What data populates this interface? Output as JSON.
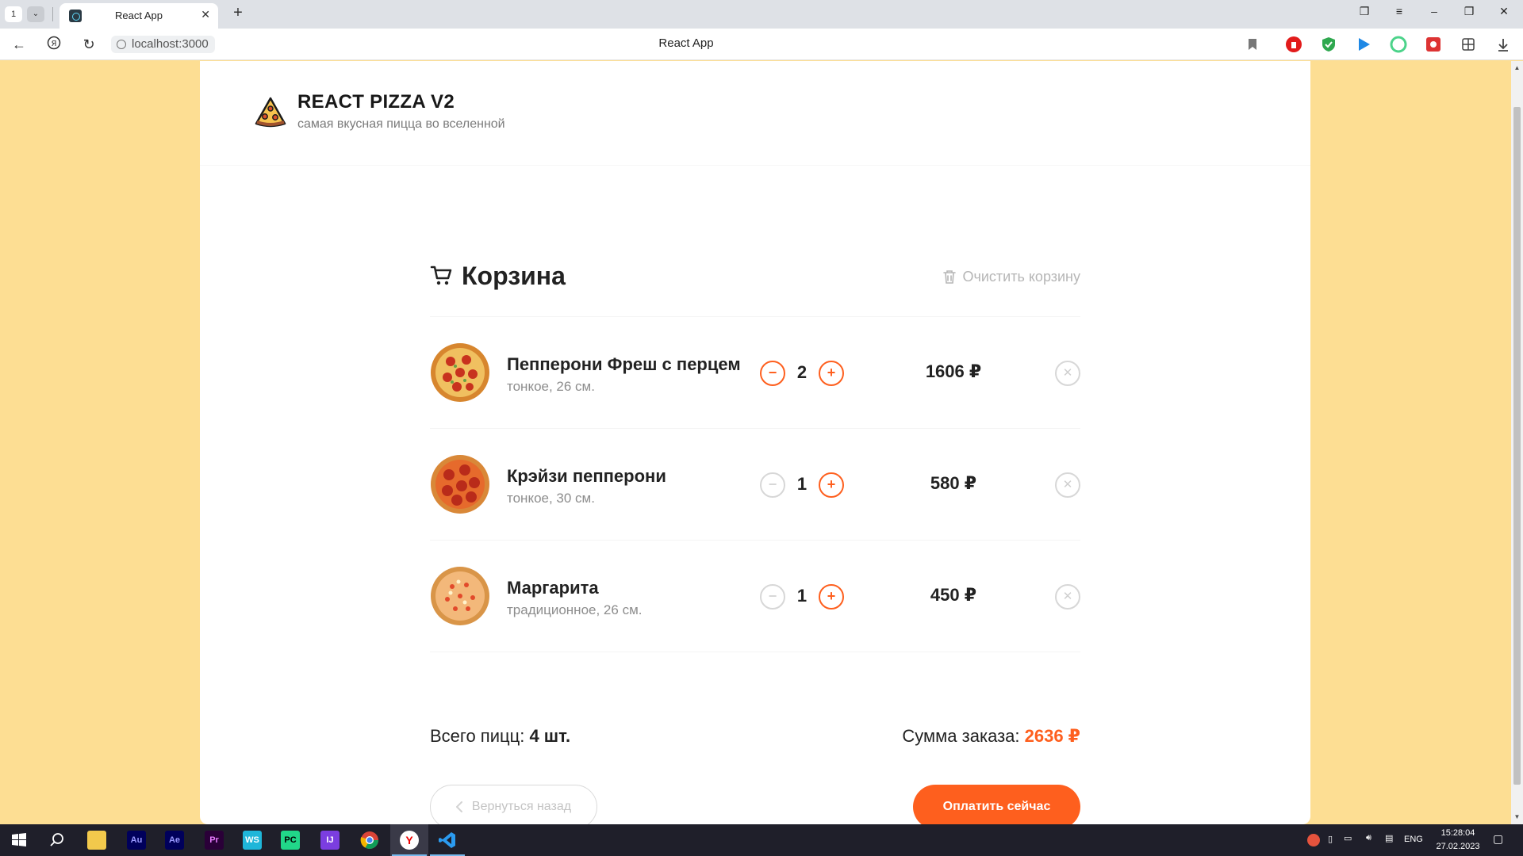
{
  "browser": {
    "tab_count": "1",
    "tab_title": "React App",
    "url": "localhost:3000",
    "page_title": "React App"
  },
  "header": {
    "logo_title": "REACT PIZZA V2",
    "logo_subtitle": "самая вкусная пицца во вселенной"
  },
  "cart": {
    "title": "Корзина",
    "clear_label": "Очистить корзину",
    "items": [
      {
        "name": "Пепперони Фреш с перцем",
        "desc": "тонкое, 26 см.",
        "count": "2",
        "price": "1606 ₽",
        "minus_enabled": true
      },
      {
        "name": "Крэйзи пепперони",
        "desc": "тонкое, 30 см.",
        "count": "1",
        "price": "580 ₽",
        "minus_enabled": false
      },
      {
        "name": "Маргарита",
        "desc": "традиционное, 26 см.",
        "count": "1",
        "price": "450 ₽",
        "minus_enabled": false
      }
    ],
    "total_count_label": "Всего пицц:",
    "total_count_value": "4 шт.",
    "total_sum_label": "Сумма заказа:",
    "total_sum_value": "2636 ₽",
    "back_label": "Вернуться назад",
    "pay_label": "Оплатить сейчас"
  },
  "taskbar": {
    "apps": [
      "windows-start",
      "search",
      "file-explorer",
      "audition",
      "after-effects",
      "premiere-pro",
      "webstorm",
      "pycharm",
      "intellij",
      "chrome",
      "yandex-browser",
      "vscode"
    ],
    "lang": "ENG",
    "time": "15:28:04",
    "date": "27.02.2023"
  },
  "colors": {
    "accent": "#fe5f1e",
    "page_bg": "#fdde93",
    "card_bg": "#ffffff"
  }
}
